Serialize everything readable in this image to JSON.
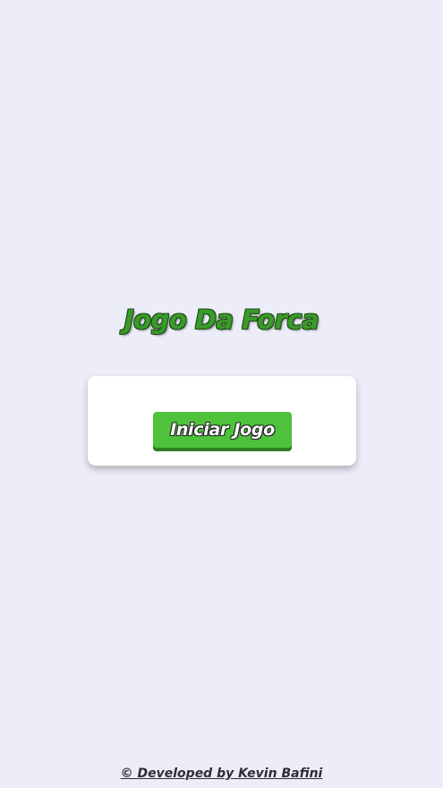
{
  "page": {
    "title": "Jogo Da Forca"
  },
  "card": {
    "start_button_label": "Iniciar Jogo"
  },
  "footer": {
    "credit": "© Developed by Kevin Bafini"
  },
  "colors": {
    "background": "#ecedf8",
    "title_green": "#3a9a2a",
    "button_green": "#4dc23a",
    "button_shadow": "#2e7d22",
    "card": "#ffffff"
  }
}
